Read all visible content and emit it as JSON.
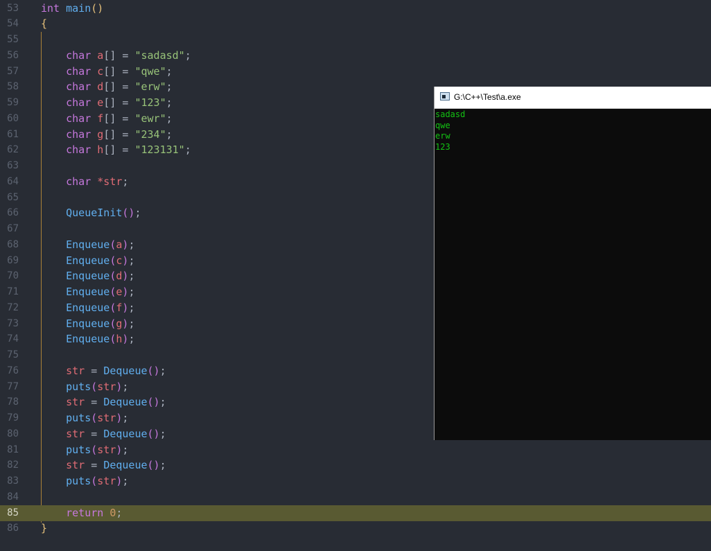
{
  "editor": {
    "current_line": "85",
    "lines": [
      {
        "n": "53",
        "t": [
          [
            "kw",
            "int"
          ],
          [
            "pun",
            " "
          ],
          [
            "fn",
            "main"
          ],
          [
            "brc",
            "()"
          ]
        ]
      },
      {
        "n": "54",
        "t": [
          [
            "brc",
            "{"
          ]
        ]
      },
      {
        "n": "55",
        "t": []
      },
      {
        "n": "56",
        "t": [
          [
            "pun",
            "    "
          ],
          [
            "kw",
            "char"
          ],
          [
            "pun",
            " "
          ],
          [
            "var",
            "a"
          ],
          [
            "pun",
            "[] = "
          ],
          [
            "str",
            "\"sadasd\""
          ],
          [
            "pun",
            ";"
          ]
        ]
      },
      {
        "n": "57",
        "t": [
          [
            "pun",
            "    "
          ],
          [
            "kw",
            "char"
          ],
          [
            "pun",
            " "
          ],
          [
            "var",
            "c"
          ],
          [
            "pun",
            "[] = "
          ],
          [
            "str",
            "\"qwe\""
          ],
          [
            "pun",
            ";"
          ]
        ]
      },
      {
        "n": "58",
        "t": [
          [
            "pun",
            "    "
          ],
          [
            "kw",
            "char"
          ],
          [
            "pun",
            " "
          ],
          [
            "var",
            "d"
          ],
          [
            "pun",
            "[] = "
          ],
          [
            "str",
            "\"erw\""
          ],
          [
            "pun",
            ";"
          ]
        ]
      },
      {
        "n": "59",
        "t": [
          [
            "pun",
            "    "
          ],
          [
            "kw",
            "char"
          ],
          [
            "pun",
            " "
          ],
          [
            "var",
            "e"
          ],
          [
            "pun",
            "[] = "
          ],
          [
            "str",
            "\"123\""
          ],
          [
            "pun",
            ";"
          ]
        ]
      },
      {
        "n": "60",
        "t": [
          [
            "pun",
            "    "
          ],
          [
            "kw",
            "char"
          ],
          [
            "pun",
            " "
          ],
          [
            "var",
            "f"
          ],
          [
            "pun",
            "[] = "
          ],
          [
            "str",
            "\"ewr\""
          ],
          [
            "pun",
            ";"
          ]
        ]
      },
      {
        "n": "61",
        "t": [
          [
            "pun",
            "    "
          ],
          [
            "kw",
            "char"
          ],
          [
            "pun",
            " "
          ],
          [
            "var",
            "g"
          ],
          [
            "pun",
            "[] = "
          ],
          [
            "str",
            "\"234\""
          ],
          [
            "pun",
            ";"
          ]
        ]
      },
      {
        "n": "62",
        "t": [
          [
            "pun",
            "    "
          ],
          [
            "kw",
            "char"
          ],
          [
            "pun",
            " "
          ],
          [
            "var",
            "h"
          ],
          [
            "pun",
            "[] = "
          ],
          [
            "str",
            "\"123131\""
          ],
          [
            "pun",
            ";"
          ]
        ]
      },
      {
        "n": "63",
        "t": []
      },
      {
        "n": "64",
        "t": [
          [
            "pun",
            "    "
          ],
          [
            "kw",
            "char"
          ],
          [
            "pun",
            " "
          ],
          [
            "var",
            "*str"
          ],
          [
            "pun",
            ";"
          ]
        ]
      },
      {
        "n": "65",
        "t": []
      },
      {
        "n": "66",
        "t": [
          [
            "pun",
            "    "
          ],
          [
            "fn",
            "QueueInit"
          ],
          [
            "par",
            "()"
          ],
          [
            "pun",
            ";"
          ]
        ]
      },
      {
        "n": "67",
        "t": []
      },
      {
        "n": "68",
        "t": [
          [
            "pun",
            "    "
          ],
          [
            "fn",
            "Enqueue"
          ],
          [
            "par",
            "("
          ],
          [
            "var",
            "a"
          ],
          [
            "par",
            ")"
          ],
          [
            "pun",
            ";"
          ]
        ]
      },
      {
        "n": "69",
        "t": [
          [
            "pun",
            "    "
          ],
          [
            "fn",
            "Enqueue"
          ],
          [
            "par",
            "("
          ],
          [
            "var",
            "c"
          ],
          [
            "par",
            ")"
          ],
          [
            "pun",
            ";"
          ]
        ]
      },
      {
        "n": "70",
        "t": [
          [
            "pun",
            "    "
          ],
          [
            "fn",
            "Enqueue"
          ],
          [
            "par",
            "("
          ],
          [
            "var",
            "d"
          ],
          [
            "par",
            ")"
          ],
          [
            "pun",
            ";"
          ]
        ]
      },
      {
        "n": "71",
        "t": [
          [
            "pun",
            "    "
          ],
          [
            "fn",
            "Enqueue"
          ],
          [
            "par",
            "("
          ],
          [
            "var",
            "e"
          ],
          [
            "par",
            ")"
          ],
          [
            "pun",
            ";"
          ]
        ]
      },
      {
        "n": "72",
        "t": [
          [
            "pun",
            "    "
          ],
          [
            "fn",
            "Enqueue"
          ],
          [
            "par",
            "("
          ],
          [
            "var",
            "f"
          ],
          [
            "par",
            ")"
          ],
          [
            "pun",
            ";"
          ]
        ]
      },
      {
        "n": "73",
        "t": [
          [
            "pun",
            "    "
          ],
          [
            "fn",
            "Enqueue"
          ],
          [
            "par",
            "("
          ],
          [
            "var",
            "g"
          ],
          [
            "par",
            ")"
          ],
          [
            "pun",
            ";"
          ]
        ]
      },
      {
        "n": "74",
        "t": [
          [
            "pun",
            "    "
          ],
          [
            "fn",
            "Enqueue"
          ],
          [
            "par",
            "("
          ],
          [
            "var",
            "h"
          ],
          [
            "par",
            ")"
          ],
          [
            "pun",
            ";"
          ]
        ]
      },
      {
        "n": "75",
        "t": []
      },
      {
        "n": "76",
        "t": [
          [
            "pun",
            "    "
          ],
          [
            "var",
            "str"
          ],
          [
            "pun",
            " = "
          ],
          [
            "fn",
            "Dequeue"
          ],
          [
            "par",
            "()"
          ],
          [
            "pun",
            ";"
          ]
        ]
      },
      {
        "n": "77",
        "t": [
          [
            "pun",
            "    "
          ],
          [
            "fn",
            "puts"
          ],
          [
            "par",
            "("
          ],
          [
            "var",
            "str"
          ],
          [
            "par",
            ")"
          ],
          [
            "pun",
            ";"
          ]
        ]
      },
      {
        "n": "78",
        "t": [
          [
            "pun",
            "    "
          ],
          [
            "var",
            "str"
          ],
          [
            "pun",
            " = "
          ],
          [
            "fn",
            "Dequeue"
          ],
          [
            "par",
            "()"
          ],
          [
            "pun",
            ";"
          ]
        ]
      },
      {
        "n": "79",
        "t": [
          [
            "pun",
            "    "
          ],
          [
            "fn",
            "puts"
          ],
          [
            "par",
            "("
          ],
          [
            "var",
            "str"
          ],
          [
            "par",
            ")"
          ],
          [
            "pun",
            ";"
          ]
        ]
      },
      {
        "n": "80",
        "t": [
          [
            "pun",
            "    "
          ],
          [
            "var",
            "str"
          ],
          [
            "pun",
            " = "
          ],
          [
            "fn",
            "Dequeue"
          ],
          [
            "par",
            "()"
          ],
          [
            "pun",
            ";"
          ]
        ]
      },
      {
        "n": "81",
        "t": [
          [
            "pun",
            "    "
          ],
          [
            "fn",
            "puts"
          ],
          [
            "par",
            "("
          ],
          [
            "var",
            "str"
          ],
          [
            "par",
            ")"
          ],
          [
            "pun",
            ";"
          ]
        ]
      },
      {
        "n": "82",
        "t": [
          [
            "pun",
            "    "
          ],
          [
            "var",
            "str"
          ],
          [
            "pun",
            " = "
          ],
          [
            "fn",
            "Dequeue"
          ],
          [
            "par",
            "()"
          ],
          [
            "pun",
            ";"
          ]
        ]
      },
      {
        "n": "83",
        "t": [
          [
            "pun",
            "    "
          ],
          [
            "fn",
            "puts"
          ],
          [
            "par",
            "("
          ],
          [
            "var",
            "str"
          ],
          [
            "par",
            ")"
          ],
          [
            "pun",
            ";"
          ]
        ]
      },
      {
        "n": "84",
        "t": []
      },
      {
        "n": "85",
        "t": [
          [
            "pun",
            "    "
          ],
          [
            "kw",
            "return"
          ],
          [
            "pun",
            " "
          ],
          [
            "num",
            "0"
          ],
          [
            "pun",
            ";"
          ]
        ]
      },
      {
        "n": "86",
        "t": [
          [
            "brc",
            "}"
          ]
        ]
      }
    ]
  },
  "console": {
    "title": "G:\\C++\\Test\\a.exe",
    "icon": "console-window-icon",
    "output": [
      "sadasd",
      "qwe",
      "erw",
      "123"
    ]
  },
  "colors": {
    "editor_bg": "#282c34",
    "current_line_bg": "#595a32",
    "console_bg": "#0c0c0c",
    "console_text": "#13c313"
  }
}
